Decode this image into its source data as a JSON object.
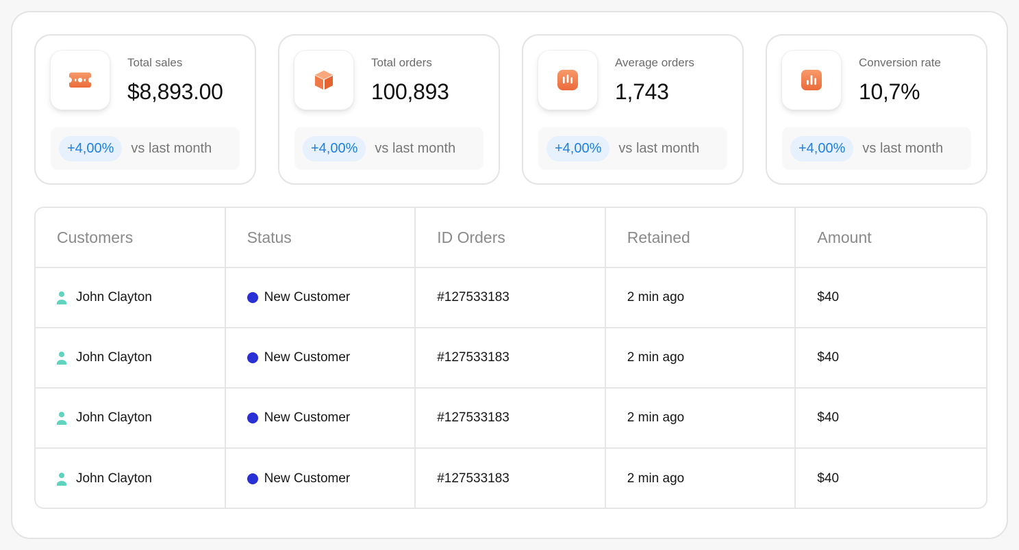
{
  "colors": {
    "accent_orange": "#f07a45",
    "pill_bg": "#e6f1fd",
    "pill_text": "#1f7fe0",
    "status_dot": "#2a2fd6",
    "avatar": "#5fd3bd"
  },
  "stats": [
    {
      "icon": "ticket-icon",
      "label": "Total sales",
      "value": "$8,893.00",
      "change": "+4,00%",
      "compare": "vs last month"
    },
    {
      "icon": "box-icon",
      "label": "Total orders",
      "value": "100,893",
      "change": "+4,00%",
      "compare": "vs last month"
    },
    {
      "icon": "bars-icon",
      "label": "Average orders",
      "value": "1,743",
      "change": "+4,00%",
      "compare": "vs last month"
    },
    {
      "icon": "bar-chart-icon",
      "label": "Conversion rate",
      "value": "10,7%",
      "change": "+4,00%",
      "compare": "vs last month"
    }
  ],
  "table": {
    "columns": [
      "Customers",
      "Status",
      "ID Orders",
      "Retained",
      "Amount"
    ],
    "rows": [
      {
        "customer": "John Clayton",
        "status": "New Customer",
        "order_id": "#127533183",
        "retained": "2 min ago",
        "amount": "$40"
      },
      {
        "customer": "John Clayton",
        "status": "New Customer",
        "order_id": "#127533183",
        "retained": "2 min ago",
        "amount": "$40"
      },
      {
        "customer": "John Clayton",
        "status": "New Customer",
        "order_id": "#127533183",
        "retained": "2 min ago",
        "amount": "$40"
      },
      {
        "customer": "John Clayton",
        "status": "New Customer",
        "order_id": "#127533183",
        "retained": "2 min ago",
        "amount": "$40"
      }
    ]
  }
}
